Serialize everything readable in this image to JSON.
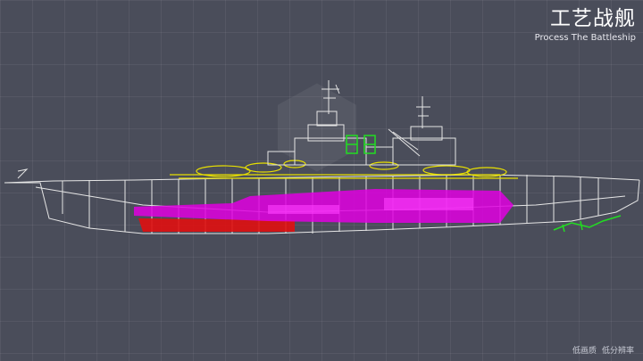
{
  "header": {
    "title": "工艺战舰",
    "subtitle": "Process The Battleship"
  },
  "footer": {
    "low_quality": "低画质",
    "low_resolution": "低分辨率"
  },
  "viewport": {
    "model": "battleship-wireframe",
    "colors": {
      "background": "#4a4d5a",
      "wireframe": "#e6e6e6",
      "deck_yellow": "#e8e000",
      "hull_magenta": "#e000e0",
      "hull_red": "#e01010",
      "highlight_green": "#22dd22"
    }
  }
}
